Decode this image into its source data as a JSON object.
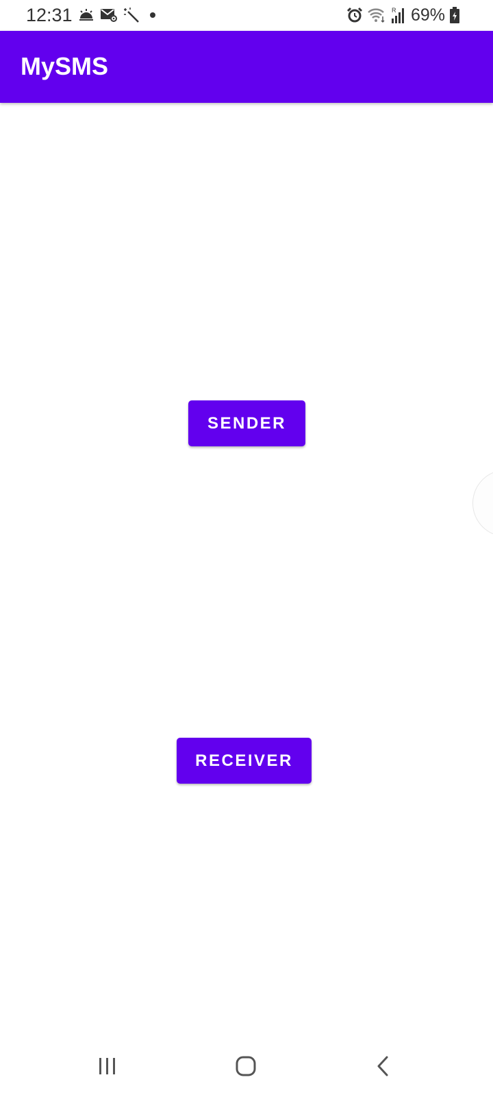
{
  "status_bar": {
    "time": "12:31",
    "battery_text": "69%",
    "left_icons": [
      "weather-icon",
      "sms-settings-icon",
      "magic-wand-icon",
      "dot-icon"
    ],
    "right_icons": [
      "alarm-icon",
      "wifi-icon",
      "signal-icon",
      "battery-charging-icon"
    ]
  },
  "app_bar": {
    "title": "MySMS",
    "color": "#6200ee"
  },
  "main": {
    "sender_label": "SENDER",
    "receiver_label": "RECEIVER",
    "button_color": "#6200ee"
  },
  "nav_bar": {
    "items": [
      "recent-apps-icon",
      "home-icon",
      "back-icon"
    ]
  }
}
